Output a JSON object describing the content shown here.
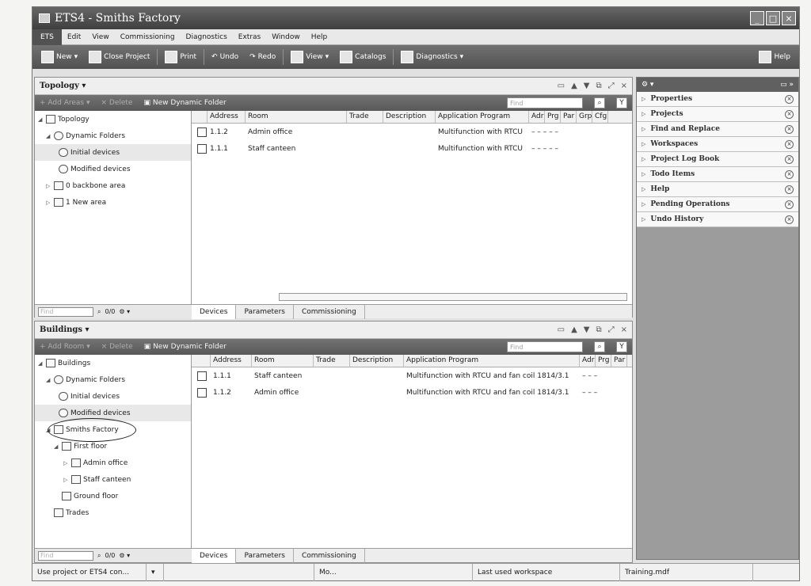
{
  "window": {
    "title": "ETS4 - Smiths Factory"
  },
  "menu": {
    "ets_tab": "ETS",
    "items": [
      "Edit",
      "View",
      "Commissioning",
      "Diagnostics",
      "Extras",
      "Window",
      "Help"
    ]
  },
  "toolbar": {
    "new_label": "New",
    "close_project_label": "Close Project",
    "print_label": "Print",
    "undo_label": "Undo",
    "redo_label": "Redo",
    "view_label": "View",
    "catalogs_label": "Catalogs",
    "diagnostics_label": "Diagnostics",
    "help_label": "Help"
  },
  "topology": {
    "title": "Topology",
    "add_label": "Add Areas",
    "delete_label": "Delete",
    "new_folder_label": "New Dynamic Folder",
    "filter_placeholder": "Find",
    "tree": [
      "Topology",
      "Dynamic Folders",
      "Initial devices",
      "Modified devices",
      "0 backbone area",
      "1 New area"
    ],
    "columns": [
      "Address",
      "Room",
      "Trade",
      "Description",
      "Application Program",
      "Adr",
      "Prg",
      "Par",
      "Grp",
      "Cfg"
    ],
    "rows": [
      {
        "address": "1.1.2",
        "room": "Admin office",
        "app": "Multifunction with RTCU",
        "flags": "–   –   –   –   –"
      },
      {
        "address": "1.1.1",
        "room": "Staff canteen",
        "app": "Multifunction with RTCU",
        "flags": "–   –   –   –   –"
      }
    ],
    "tabs": [
      "Devices",
      "Parameters",
      "Commissioning"
    ],
    "find_placeholder": "Find",
    "count": "0/0"
  },
  "buildings": {
    "title": "Buildings",
    "add_label": "Add Room",
    "delete_label": "Delete",
    "new_folder_label": "New Dynamic Folder",
    "filter_placeholder": "Find",
    "tree": [
      "Buildings",
      "Dynamic Folders",
      "Initial devices",
      "Modified devices",
      "Smiths Factory",
      "First floor",
      "Admin office",
      "Staff canteen",
      "Ground floor",
      "Trades"
    ],
    "columns": [
      "Address",
      "Room",
      "Trade",
      "Description",
      "Application Program",
      "Adr",
      "Prg",
      "Par"
    ],
    "rows": [
      {
        "address": "1.1.1",
        "room": "Staff canteen",
        "app": "Multifunction with RTCU and fan coil 1814/3.1",
        "flags": "–   –   –"
      },
      {
        "address": "1.1.2",
        "room": "Admin office",
        "app": "Multifunction with RTCU and fan coil 1814/3.1",
        "flags": "–   –   –"
      }
    ],
    "tabs": [
      "Devices",
      "Parameters",
      "Commissioning"
    ],
    "find_placeholder": "Find",
    "count": "0/0"
  },
  "dock": {
    "items": [
      "Properties",
      "Projects",
      "Find and Replace",
      "Workspaces",
      "Project Log Book",
      "Todo Items",
      "Help",
      "Pending Operations",
      "Undo History"
    ]
  },
  "status": {
    "hint": "Use project or ETS4 con...",
    "mode": "Mo...",
    "workspace_label": "Last used workspace",
    "file": "Training.mdf"
  }
}
